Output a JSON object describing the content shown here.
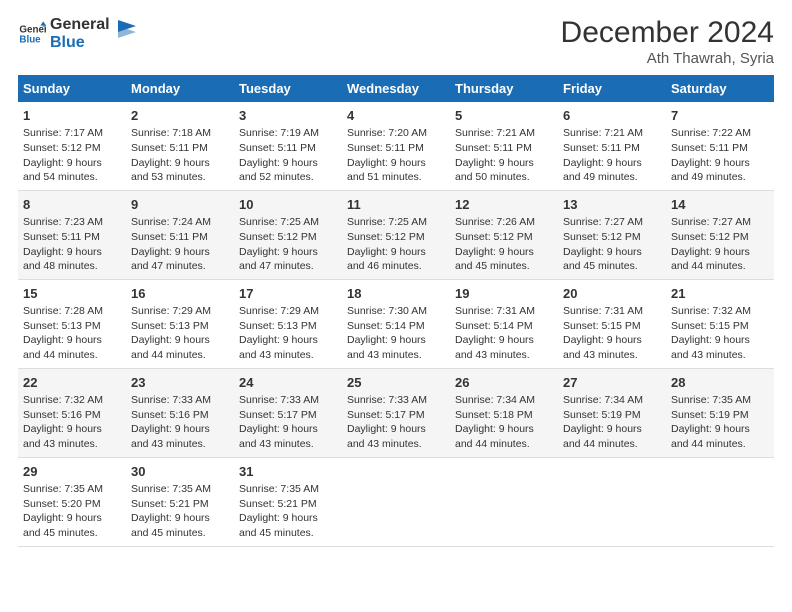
{
  "header": {
    "logo_general": "General",
    "logo_blue": "Blue",
    "title": "December 2024",
    "subtitle": "Ath Thawrah, Syria"
  },
  "columns": [
    "Sunday",
    "Monday",
    "Tuesday",
    "Wednesday",
    "Thursday",
    "Friday",
    "Saturday"
  ],
  "rows": [
    [
      {
        "day": "1",
        "lines": [
          "Sunrise: 7:17 AM",
          "Sunset: 5:12 PM",
          "Daylight: 9 hours",
          "and 54 minutes."
        ]
      },
      {
        "day": "2",
        "lines": [
          "Sunrise: 7:18 AM",
          "Sunset: 5:11 PM",
          "Daylight: 9 hours",
          "and 53 minutes."
        ]
      },
      {
        "day": "3",
        "lines": [
          "Sunrise: 7:19 AM",
          "Sunset: 5:11 PM",
          "Daylight: 9 hours",
          "and 52 minutes."
        ]
      },
      {
        "day": "4",
        "lines": [
          "Sunrise: 7:20 AM",
          "Sunset: 5:11 PM",
          "Daylight: 9 hours",
          "and 51 minutes."
        ]
      },
      {
        "day": "5",
        "lines": [
          "Sunrise: 7:21 AM",
          "Sunset: 5:11 PM",
          "Daylight: 9 hours",
          "and 50 minutes."
        ]
      },
      {
        "day": "6",
        "lines": [
          "Sunrise: 7:21 AM",
          "Sunset: 5:11 PM",
          "Daylight: 9 hours",
          "and 49 minutes."
        ]
      },
      {
        "day": "7",
        "lines": [
          "Sunrise: 7:22 AM",
          "Sunset: 5:11 PM",
          "Daylight: 9 hours",
          "and 49 minutes."
        ]
      }
    ],
    [
      {
        "day": "8",
        "lines": [
          "Sunrise: 7:23 AM",
          "Sunset: 5:11 PM",
          "Daylight: 9 hours",
          "and 48 minutes."
        ]
      },
      {
        "day": "9",
        "lines": [
          "Sunrise: 7:24 AM",
          "Sunset: 5:11 PM",
          "Daylight: 9 hours",
          "and 47 minutes."
        ]
      },
      {
        "day": "10",
        "lines": [
          "Sunrise: 7:25 AM",
          "Sunset: 5:12 PM",
          "Daylight: 9 hours",
          "and 47 minutes."
        ]
      },
      {
        "day": "11",
        "lines": [
          "Sunrise: 7:25 AM",
          "Sunset: 5:12 PM",
          "Daylight: 9 hours",
          "and 46 minutes."
        ]
      },
      {
        "day": "12",
        "lines": [
          "Sunrise: 7:26 AM",
          "Sunset: 5:12 PM",
          "Daylight: 9 hours",
          "and 45 minutes."
        ]
      },
      {
        "day": "13",
        "lines": [
          "Sunrise: 7:27 AM",
          "Sunset: 5:12 PM",
          "Daylight: 9 hours",
          "and 45 minutes."
        ]
      },
      {
        "day": "14",
        "lines": [
          "Sunrise: 7:27 AM",
          "Sunset: 5:12 PM",
          "Daylight: 9 hours",
          "and 44 minutes."
        ]
      }
    ],
    [
      {
        "day": "15",
        "lines": [
          "Sunrise: 7:28 AM",
          "Sunset: 5:13 PM",
          "Daylight: 9 hours",
          "and 44 minutes."
        ]
      },
      {
        "day": "16",
        "lines": [
          "Sunrise: 7:29 AM",
          "Sunset: 5:13 PM",
          "Daylight: 9 hours",
          "and 44 minutes."
        ]
      },
      {
        "day": "17",
        "lines": [
          "Sunrise: 7:29 AM",
          "Sunset: 5:13 PM",
          "Daylight: 9 hours",
          "and 43 minutes."
        ]
      },
      {
        "day": "18",
        "lines": [
          "Sunrise: 7:30 AM",
          "Sunset: 5:14 PM",
          "Daylight: 9 hours",
          "and 43 minutes."
        ]
      },
      {
        "day": "19",
        "lines": [
          "Sunrise: 7:31 AM",
          "Sunset: 5:14 PM",
          "Daylight: 9 hours",
          "and 43 minutes."
        ]
      },
      {
        "day": "20",
        "lines": [
          "Sunrise: 7:31 AM",
          "Sunset: 5:15 PM",
          "Daylight: 9 hours",
          "and 43 minutes."
        ]
      },
      {
        "day": "21",
        "lines": [
          "Sunrise: 7:32 AM",
          "Sunset: 5:15 PM",
          "Daylight: 9 hours",
          "and 43 minutes."
        ]
      }
    ],
    [
      {
        "day": "22",
        "lines": [
          "Sunrise: 7:32 AM",
          "Sunset: 5:16 PM",
          "Daylight: 9 hours",
          "and 43 minutes."
        ]
      },
      {
        "day": "23",
        "lines": [
          "Sunrise: 7:33 AM",
          "Sunset: 5:16 PM",
          "Daylight: 9 hours",
          "and 43 minutes."
        ]
      },
      {
        "day": "24",
        "lines": [
          "Sunrise: 7:33 AM",
          "Sunset: 5:17 PM",
          "Daylight: 9 hours",
          "and 43 minutes."
        ]
      },
      {
        "day": "25",
        "lines": [
          "Sunrise: 7:33 AM",
          "Sunset: 5:17 PM",
          "Daylight: 9 hours",
          "and 43 minutes."
        ]
      },
      {
        "day": "26",
        "lines": [
          "Sunrise: 7:34 AM",
          "Sunset: 5:18 PM",
          "Daylight: 9 hours",
          "and 44 minutes."
        ]
      },
      {
        "day": "27",
        "lines": [
          "Sunrise: 7:34 AM",
          "Sunset: 5:19 PM",
          "Daylight: 9 hours",
          "and 44 minutes."
        ]
      },
      {
        "day": "28",
        "lines": [
          "Sunrise: 7:35 AM",
          "Sunset: 5:19 PM",
          "Daylight: 9 hours",
          "and 44 minutes."
        ]
      }
    ],
    [
      {
        "day": "29",
        "lines": [
          "Sunrise: 7:35 AM",
          "Sunset: 5:20 PM",
          "Daylight: 9 hours",
          "and 45 minutes."
        ]
      },
      {
        "day": "30",
        "lines": [
          "Sunrise: 7:35 AM",
          "Sunset: 5:21 PM",
          "Daylight: 9 hours",
          "and 45 minutes."
        ]
      },
      {
        "day": "31",
        "lines": [
          "Sunrise: 7:35 AM",
          "Sunset: 5:21 PM",
          "Daylight: 9 hours",
          "and 45 minutes."
        ]
      },
      {
        "day": "",
        "lines": []
      },
      {
        "day": "",
        "lines": []
      },
      {
        "day": "",
        "lines": []
      },
      {
        "day": "",
        "lines": []
      }
    ]
  ]
}
